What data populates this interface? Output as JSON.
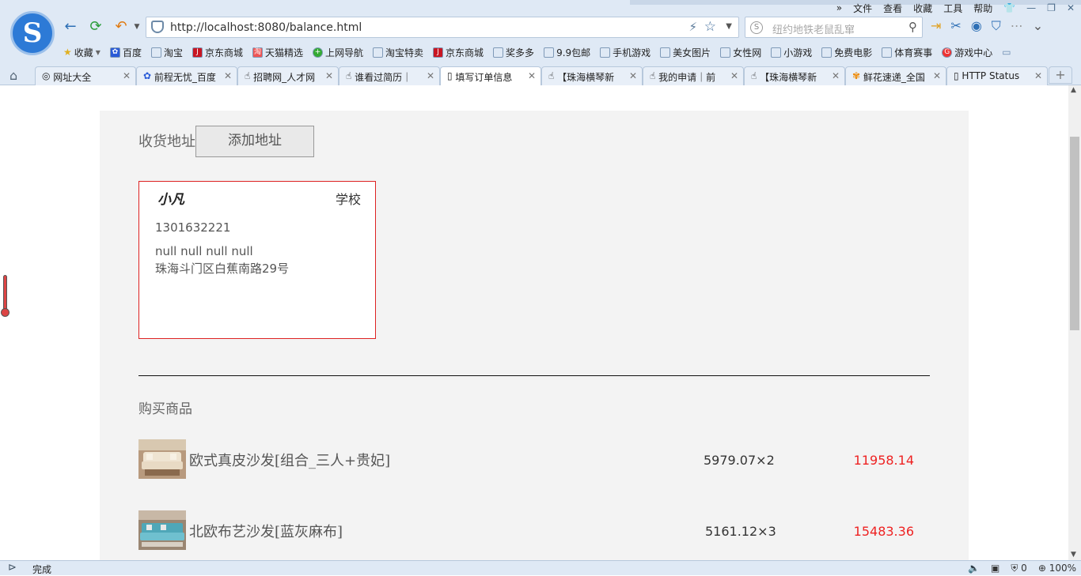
{
  "browser": {
    "logo_letter": "S",
    "menu": [
      "»",
      "文件",
      "查看",
      "收藏",
      "工具",
      "帮助"
    ],
    "url": "http://localhost:8080/balance.html",
    "search_placeholder": "纽约地铁老鼠乱窜",
    "bookmarks": [
      "收藏",
      "百度",
      "淘宝",
      "京东商城",
      "天猫精选",
      "上网导航",
      "淘宝特卖",
      "京东商城",
      "奖多多",
      "9.9包邮",
      "手机游戏",
      "美女图片",
      "女性网",
      "小游戏",
      "免费电影",
      "体育赛事",
      "游戏中心"
    ],
    "tabs": [
      "网址大全",
      "前程无忧_百度",
      "招聘网_人才网",
      "谁看过简历｜",
      "填写订单信息",
      "【珠海横琴新",
      "我的申请｜前",
      "【珠海横琴新",
      "鲜花速递_全国",
      "HTTP Status"
    ],
    "active_tab_index": 4,
    "status_text": "完成",
    "status_right": [
      "0",
      "100%"
    ]
  },
  "page": {
    "address_label": "收货地址",
    "add_address_button": "添加地址",
    "address_card": {
      "name": "小凡",
      "tag": "学校",
      "phone": "1301632221",
      "region": "null null null null",
      "detail": "珠海斗门区白蕉南路29号"
    },
    "products_title": "购买商品",
    "products": [
      {
        "name": "欧式真皮沙发[组合_三人+贵妃]",
        "price_qty": "5979.07×2",
        "total": "11958.14"
      },
      {
        "name": "北欧布艺沙发[蓝灰麻布]",
        "price_qty": "5161.12×3",
        "total": "15483.36"
      }
    ]
  },
  "colors": {
    "accent_red": "#e22222",
    "card_border": "#dd2222",
    "panel_bg": "#f3f3f3"
  }
}
